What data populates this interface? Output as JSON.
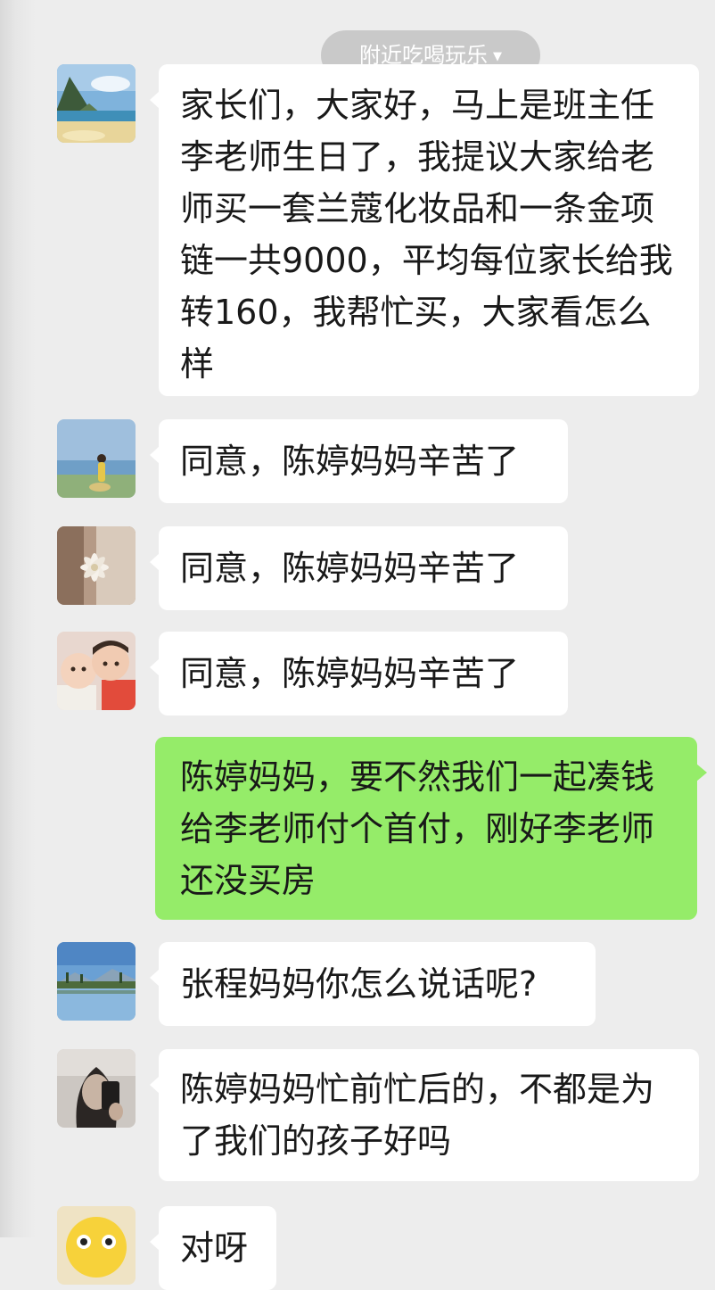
{
  "header": {
    "pill_label": "附近吃喝玩乐",
    "pill_icon": "caret-down-icon"
  },
  "messages": [
    {
      "side": "in",
      "avatar": "avatar-island-coast",
      "text": "家长们，大家好，马上是班主任李老师生日了，我提议大家给老师买一套兰蔻化妆品和一条金项链一共9000，平均每位家长给我转160，我帮忙买，大家看怎么样"
    },
    {
      "side": "in",
      "avatar": "avatar-woman-beach",
      "text": "同意，陈婷妈妈辛苦了"
    },
    {
      "side": "in",
      "avatar": "avatar-white-flower",
      "text": "同意，陈婷妈妈辛苦了"
    },
    {
      "side": "in",
      "avatar": "avatar-two-babies",
      "text": "同意，陈婷妈妈辛苦了"
    },
    {
      "side": "out",
      "avatar": "",
      "text": "陈婷妈妈，要不然我们一起凑钱给李老师付个首付，刚好李老师还没买房"
    },
    {
      "side": "in",
      "avatar": "avatar-lake-landscape",
      "text": "张程妈妈你怎么说话呢?"
    },
    {
      "side": "in",
      "avatar": "avatar-selfie-person",
      "text": "陈婷妈妈忙前忙后的，不都是为了我们的孩子好吗"
    },
    {
      "side": "in",
      "avatar": "avatar-cartoon-face",
      "text": "对呀"
    }
  ],
  "colors": {
    "background": "#ededed",
    "incoming_bubble": "#ffffff",
    "outgoing_bubble": "#95ec69",
    "text": "#191919",
    "pill": "#c9c9c9"
  }
}
